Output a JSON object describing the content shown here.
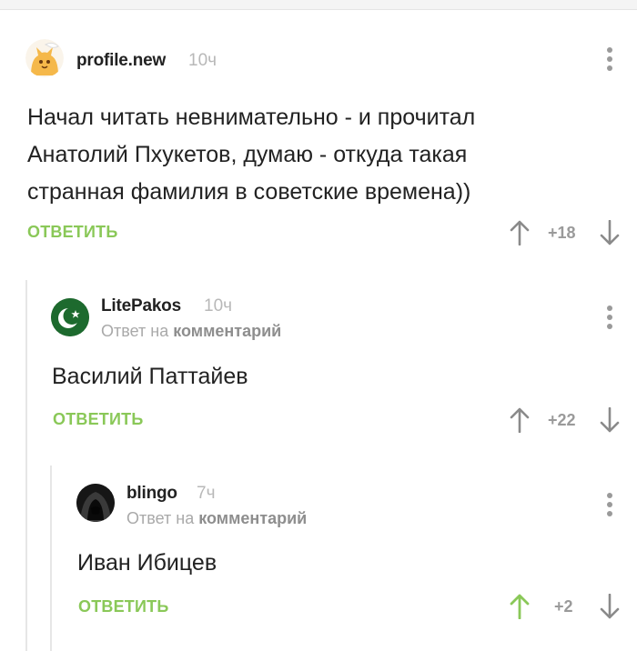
{
  "comments": [
    {
      "username": "profile.new",
      "time": "10ч",
      "text": "Начал читать невнимательно - и прочитал Анатолий Пхукетов, думаю - откуда такая странная фамилия в советские времена))",
      "reply_label": "ОТВЕТИТЬ",
      "rating": "+18"
    },
    {
      "username": "LitePakos",
      "time": "10ч",
      "reply_to_prefix": "Ответ на",
      "reply_to_target": "комментарий",
      "text": "Василий Паттайев",
      "reply_label": "ОТВЕТИТЬ",
      "rating": "+22"
    },
    {
      "username": "blingo",
      "time": "7ч",
      "reply_to_prefix": "Ответ на",
      "reply_to_target": "комментарий",
      "text": "Иван Ибицев",
      "reply_label": "ОТВЕТИТЬ",
      "rating": "+2",
      "upvoted": true
    }
  ],
  "icons": {
    "upvote": "arrow-up-icon",
    "downvote": "arrow-down-icon",
    "menu": "more-vertical-icon"
  },
  "colors": {
    "accent_green": "#8ac858",
    "muted_gray": "#9a9a9a",
    "upvoted_green": "#8ac858"
  }
}
